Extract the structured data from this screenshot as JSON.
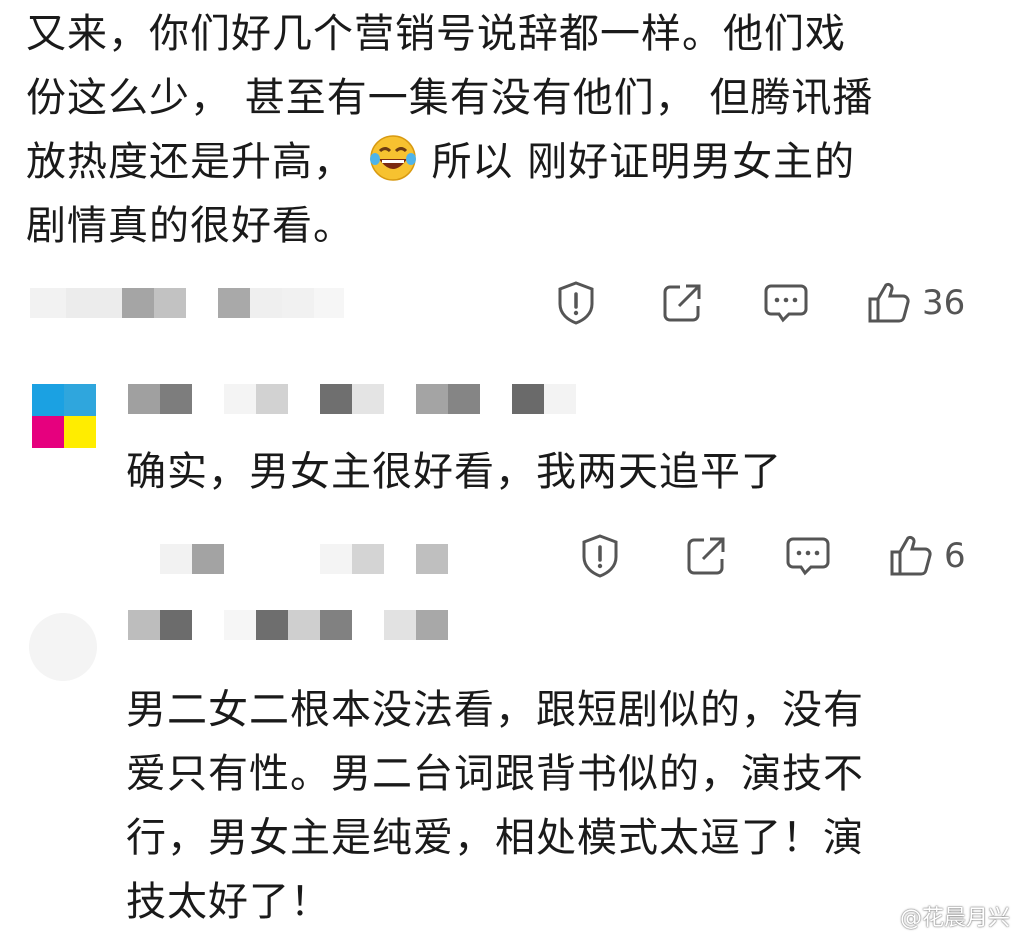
{
  "comments": [
    {
      "lines": [
        "又来，你们好几个营销号说辞都一样。他们戏",
        "份这么少， 甚至有一集有没有他们， 但腾讯播",
        "放热度还是升高，",
        "剧情真的很好看。"
      ],
      "line3_after_emoji": " 所以 刚好证明男女主的",
      "emoji": "laughing-crying-emoji",
      "likes": "36"
    },
    {
      "text": "确实，男女主很好看，我两天追平了",
      "likes": "6"
    },
    {
      "lines": [
        "男二女二根本没法看，跟短剧似的，没有",
        "爱只有性。男二台词跟背书似的，演技不",
        "行，男女主是纯爱，相处模式太逗了！演",
        "技太好了！"
      ]
    }
  ],
  "actions": {
    "report_icon": "warning-shield-icon",
    "share_icon": "share-icon",
    "comment_icon": "comment-bubble-icon",
    "like_icon": "thumbs-up-icon"
  },
  "watermark": "@花晨月兴",
  "colors": {
    "text": "#1a1a1a",
    "icon": "#555555",
    "avatar_blue": "#1ba1e2",
    "avatar_magenta": "#e6007e",
    "avatar_yellow": "#ffed00"
  }
}
